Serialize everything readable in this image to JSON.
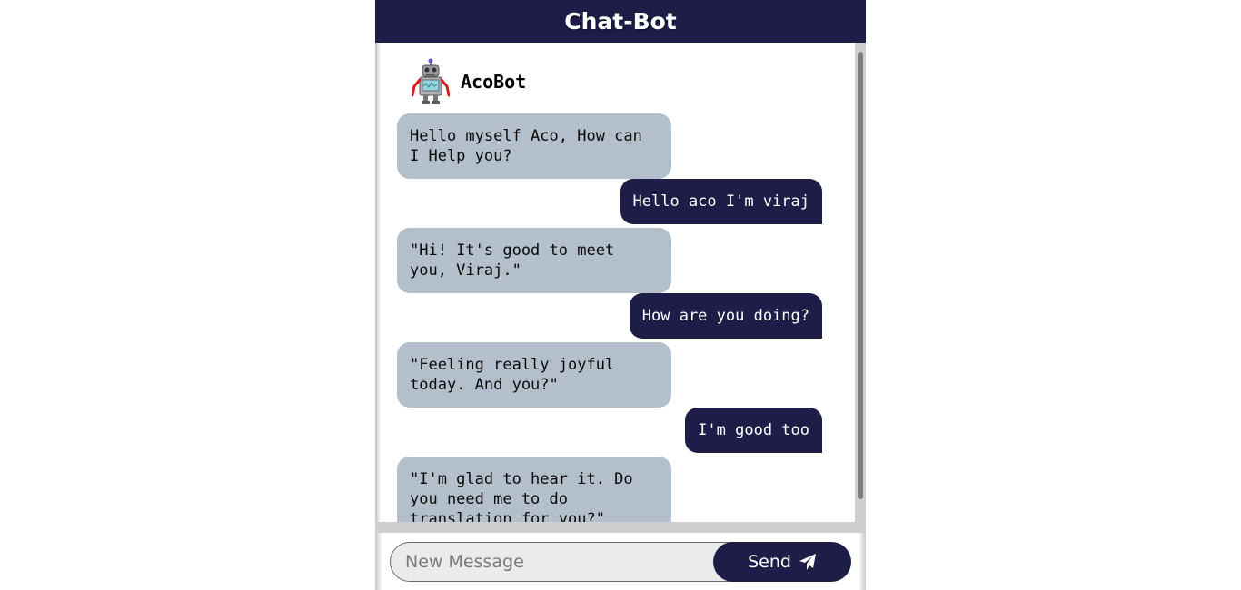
{
  "header": {
    "title": "Chat-Bot"
  },
  "bot": {
    "name": "AcoBot",
    "avatar_icon": "robot-icon"
  },
  "messages": [
    {
      "sender": "bot",
      "text": "Hello myself Aco, How can I Help you?"
    },
    {
      "sender": "user",
      "text": "Hello aco I'm viraj"
    },
    {
      "sender": "bot",
      "text": "\"Hi! It's good to meet you, Viraj.\""
    },
    {
      "sender": "user",
      "text": "How are you doing?"
    },
    {
      "sender": "bot",
      "text": "\"Feeling really joyful today. And you?\""
    },
    {
      "sender": "user",
      "text": "I'm good too"
    },
    {
      "sender": "bot",
      "text": "\"I'm glad to hear it. Do you need me to do translation for you?\""
    }
  ],
  "composer": {
    "placeholder": "New Message",
    "send_label": "Send",
    "send_icon": "paper-plane-icon"
  },
  "colors": {
    "header_bg": "#1d1d48",
    "user_bubble": "#1d1d48",
    "bot_bubble": "#b3bfca"
  }
}
